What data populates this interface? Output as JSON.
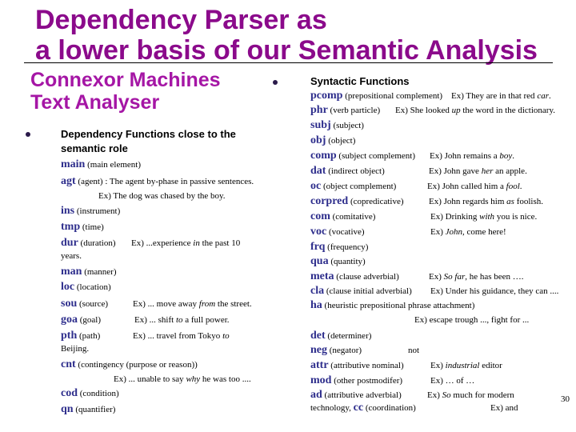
{
  "slide": {
    "title_line1": "Dependency Parser as",
    "title_line2": "a lower basis of our Semantic Analysis",
    "subtitle_line1": "Connexor Machines",
    "subtitle_line2": "Text Analyser",
    "page_number": "30"
  },
  "left": {
    "heading_line1": "Dependency Functions close to the",
    "heading_line2": "semantic role",
    "items": [
      {
        "code": "main",
        "desc": "(main element)"
      },
      {
        "code": "agt",
        "desc": "(agent) : The agent by-phase in passive sentences."
      },
      {
        "example": "Ex) The dog was chased by the boy."
      },
      {
        "code": "ins",
        "desc": "(instrument)"
      },
      {
        "code": "tmp",
        "desc": "(time)"
      },
      {
        "code": "dur",
        "desc": "(duration)",
        "ex_pre": "Ex) ...experience ",
        "ex_it": "in",
        "ex_post": " the past 10",
        "wrap": "years."
      },
      {
        "code": "man",
        "desc": "(manner)"
      },
      {
        "code": "loc",
        "desc": "(location)"
      },
      {
        "code": "sou",
        "desc": "(source)",
        "ex_pre": "Ex) ... move away ",
        "ex_it": "from",
        "ex_post": " the street."
      },
      {
        "code": "goa",
        "desc": "(goal)",
        "ex_pre": "Ex) ... shift ",
        "ex_it": "to",
        "ex_post": " a full power."
      },
      {
        "code": "pth",
        "desc": "(path)",
        "ex_pre": "Ex) ... travel from Tokyo ",
        "ex_it": "to",
        "ex_post": "",
        "wrap": "Beijing."
      },
      {
        "code": "cnt",
        "desc": "(contingency (purpose or reason))"
      },
      {
        "ex_pre": "Ex) ... unable to say ",
        "ex_it": "why",
        "ex_post": " he was too ...."
      },
      {
        "code": "cod",
        "desc": "(condition)"
      },
      {
        "code": "qn",
        "desc": "(quantifier)"
      }
    ]
  },
  "right": {
    "heading": "Syntactic Functions",
    "items": [
      {
        "code": "pcomp",
        "desc": "(prepositional complement)",
        "ex_pre": "Ex) They are in that red ",
        "ex_it": "car",
        "ex_post": "."
      },
      {
        "code": "phr",
        "desc": "(verb particle)",
        "ex_pre": "Ex) She looked ",
        "ex_it": "up",
        "ex_post": " the word in the dictionary."
      },
      {
        "code": "subj",
        "desc": "(subject)"
      },
      {
        "code": "obj",
        "desc": "(object)"
      },
      {
        "code": "comp",
        "desc": "(subject complement)",
        "ex_pre": "Ex) John remains a ",
        "ex_it": "boy",
        "ex_post": "."
      },
      {
        "code": "dat",
        "desc": "(indirect object)",
        "ex_pre": "Ex) John gave ",
        "ex_it": "her",
        "ex_post": " an apple."
      },
      {
        "code": "oc",
        "desc": "(object complement)",
        "ex_pre": "Ex) John called him a ",
        "ex_it": "fool",
        "ex_post": "."
      },
      {
        "code": "corpred",
        "desc": "(copredicative)",
        "ex_pre": "Ex) John regards him ",
        "ex_it": "as",
        "ex_post": " foolish."
      },
      {
        "code": "com",
        "desc": "(comitative)",
        "ex_pre": "Ex) Drinking ",
        "ex_it": "with",
        "ex_post": " you is nice."
      },
      {
        "code": "voc",
        "desc": "(vocative)",
        "ex_pre": "Ex) ",
        "ex_it": "John",
        "ex_post": ", come here!"
      },
      {
        "code": "frq",
        "desc": "(frequency)"
      },
      {
        "code": "qua",
        "desc": "(quantity)"
      },
      {
        "code": "meta",
        "desc": "(clause adverbial)",
        "ex_pre": "Ex) ",
        "ex_it": "So far",
        "ex_post": ", he has been …."
      },
      {
        "code": "cla",
        "desc": "(clause initial adverbial)",
        "ex_pre": "Ex) Under his guidance, they can ....",
        "ex_it": "",
        "ex_post": ""
      },
      {
        "code": "ha",
        "desc": "(heuristic prepositional phrase attachment)"
      },
      {
        "ex_pre": "Ex) escape trough ...,  fight for ...",
        "ex_it": "",
        "ex_post": ""
      },
      {
        "code": "det",
        "desc": "(determiner)"
      },
      {
        "code": "neg",
        "desc": "(negator)",
        "ex_pre": "not",
        "ex_it": "",
        "ex_post": ""
      },
      {
        "code": "attr",
        "desc": "(attributive nominal)",
        "ex_pre": "Ex) ",
        "ex_it": "industrial",
        "ex_post": " editor"
      },
      {
        "code": "mod",
        "desc": "(other postmodifer)",
        "ex_pre": "Ex) … of …",
        "ex_it": "",
        "ex_post": ""
      },
      {
        "code": "ad",
        "desc": "(attributive adverbial)",
        "ex_pre": "Ex) ",
        "ex_it": "So",
        "ex_post": " much for modern"
      },
      {
        "pre": "technology, ",
        "code": "cc",
        "desc": "(coordination)",
        "ex_pre": "Ex) and",
        "ex_it": "",
        "ex_post": ""
      }
    ]
  }
}
